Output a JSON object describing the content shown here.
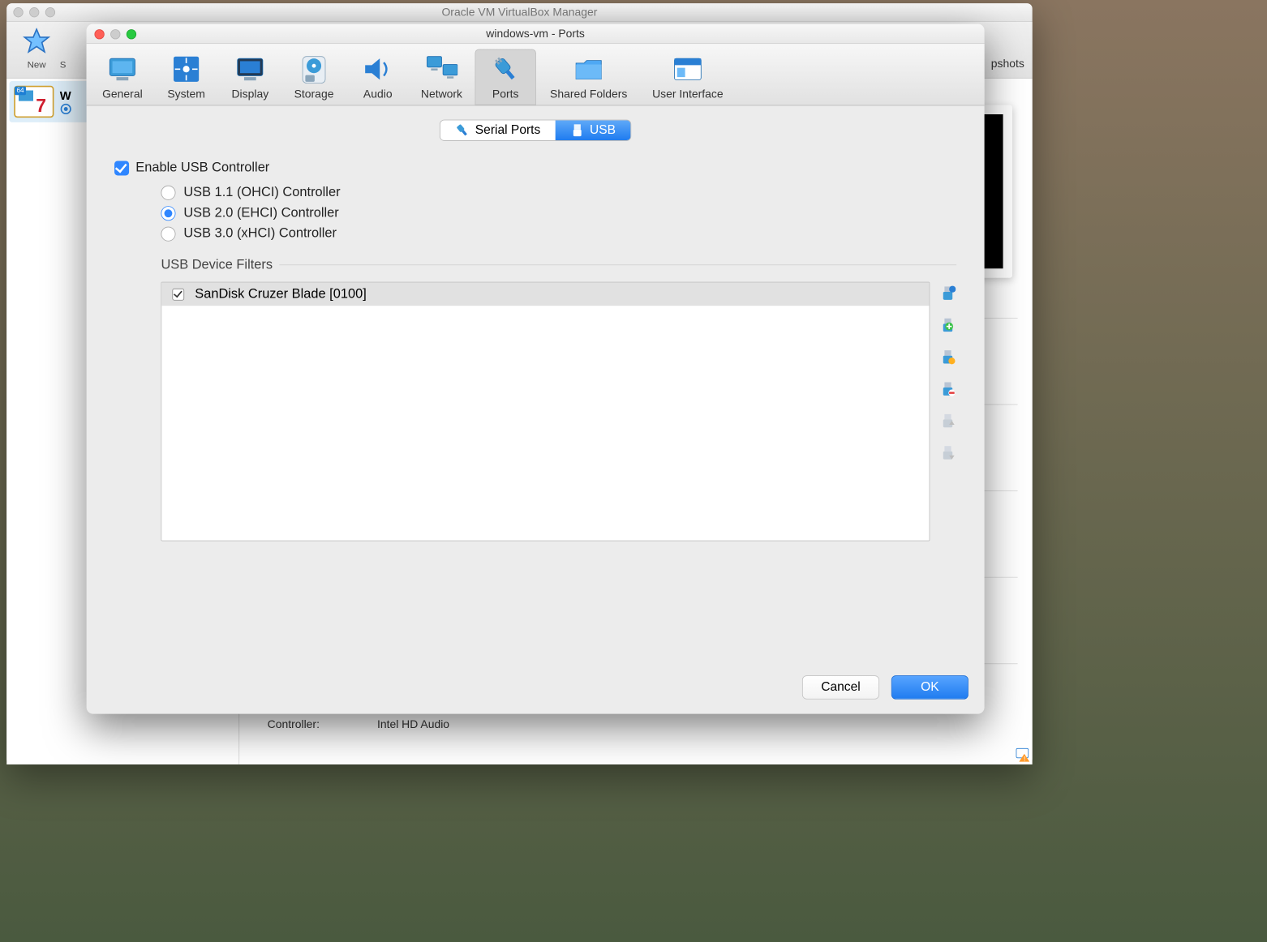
{
  "main": {
    "title": "Oracle VM VirtualBox Manager",
    "toolbar": {
      "new": "New",
      "settings_visible": "S"
    },
    "snapshots_tab": "pshots",
    "vm": {
      "name": "W",
      "os_badge": "64"
    },
    "audio": {
      "controller_label": "Controller:",
      "controller_value": "Intel HD Audio"
    }
  },
  "dialog": {
    "title": "windows-vm - Ports",
    "categories": [
      {
        "id": "general",
        "label": "General"
      },
      {
        "id": "system",
        "label": "System"
      },
      {
        "id": "display",
        "label": "Display"
      },
      {
        "id": "storage",
        "label": "Storage"
      },
      {
        "id": "audio",
        "label": "Audio"
      },
      {
        "id": "network",
        "label": "Network"
      },
      {
        "id": "ports",
        "label": "Ports",
        "selected": true
      },
      {
        "id": "shared",
        "label": "Shared Folders"
      },
      {
        "id": "ui",
        "label": "User Interface"
      }
    ],
    "tabs": {
      "serial": "Serial Ports",
      "usb": "USB",
      "selected": "usb"
    },
    "enable_label": "Enable USB Controller",
    "enable_checked": true,
    "controllers": [
      {
        "id": "ohci",
        "label": "USB 1.1 (OHCI) Controller",
        "on": false
      },
      {
        "id": "ehci",
        "label": "USB 2.0 (EHCI) Controller",
        "on": true
      },
      {
        "id": "xhci",
        "label": "USB 3.0 (xHCI) Controller",
        "on": false
      }
    ],
    "filters_label": "USB Device Filters",
    "filters": [
      {
        "checked": true,
        "name": "SanDisk Cruzer Blade [0100]"
      }
    ],
    "filter_actions": [
      "add-empty",
      "add-device",
      "edit",
      "remove",
      "move-up",
      "move-down"
    ],
    "cancel": "Cancel",
    "ok": "OK"
  }
}
